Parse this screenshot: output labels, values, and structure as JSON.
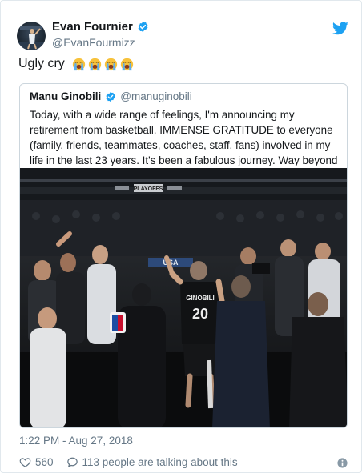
{
  "tweet": {
    "author": {
      "display_name": "Evan Fournier",
      "handle": "@EvanFourmizz",
      "verified": true
    },
    "text": "Ugly cry",
    "emoji_count": 4,
    "timestamp": "1:22 PM - Aug 27, 2018",
    "likes": "560",
    "talking": "113 people are talking about this"
  },
  "quote": {
    "author": {
      "display_name": "Manu Ginobili",
      "handle": "@manuginobili",
      "verified": true
    },
    "text": "Today, with a wide range of feelings, I'm announcing my retirement from basketball. IMMENSE GRATITUDE to everyone (family, friends, teammates, coaches, staff, fans) involved in my life in the last 23 years. It's been a fabulous journey. Way beyond my wildest dreams.",
    "photo": {
      "jersey_name": "GINOBILI",
      "jersey_number": "20",
      "banner_text": "USA",
      "scoreboard_text": "PLAYOFFS"
    }
  },
  "icons": {
    "brand": "twitter-bird-icon",
    "verified": "verified-badge-icon",
    "like": "heart-icon",
    "talk": "speech-bubble-icon",
    "info": "info-icon",
    "emoji": "loudly-crying-face-emoji"
  },
  "colors": {
    "twitter_blue": "#1da1f2",
    "muted_text": "#657786",
    "emoji_yellow": "#f7c23c",
    "tears_blue": "#5dadec"
  }
}
